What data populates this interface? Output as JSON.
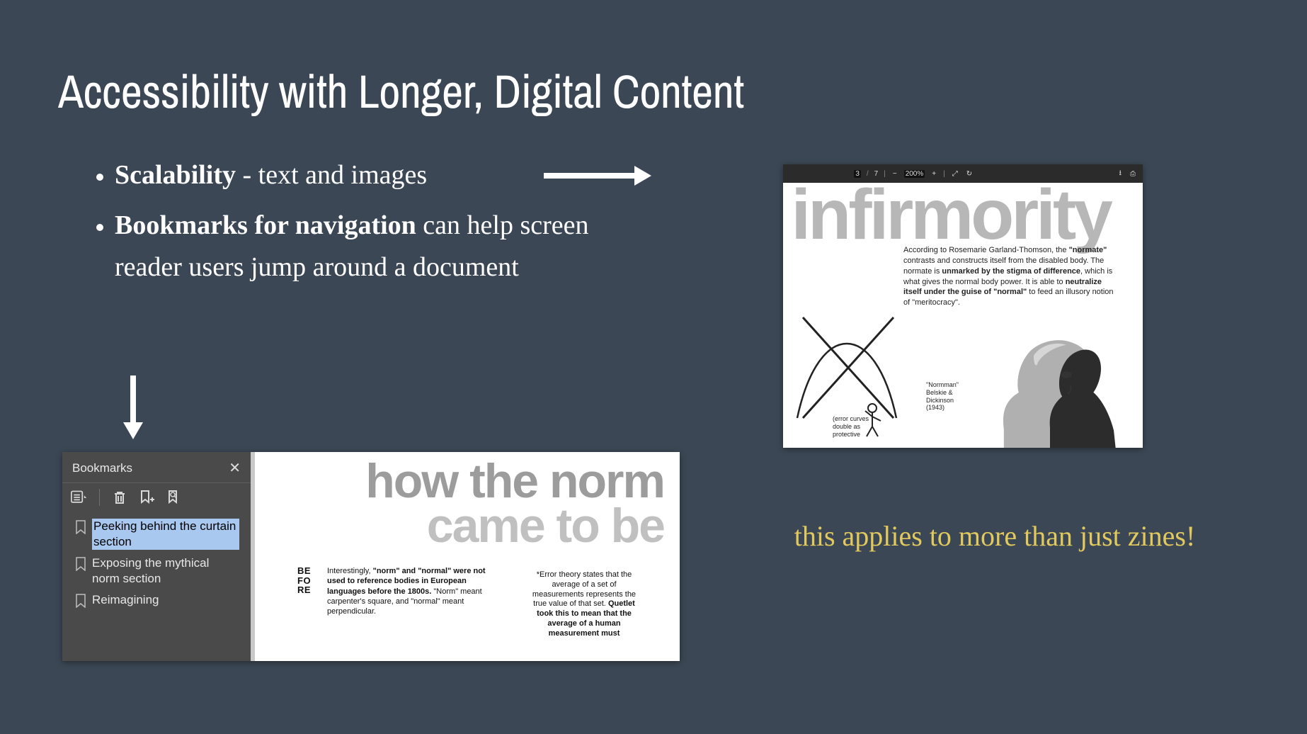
{
  "title": "Accessibility with Longer, Digital Content",
  "bullets": [
    {
      "lead": "Scalability",
      "rest": " - text and images"
    },
    {
      "lead": "Bookmarks for navigation",
      "rest": " can help screen reader users jump around a document"
    }
  ],
  "caption": "this applies to more than just zines!",
  "pdf": {
    "toolbar": {
      "page_cur": "3",
      "page_sep": "/",
      "page_total": "7",
      "zoom_minus": "−",
      "zoom_val": "200%",
      "zoom_plus": "+",
      "fit_page": "⤢",
      "rotate": "↻",
      "download": "⭳",
      "print": "⎙"
    },
    "bigword": "e infirmority",
    "para_1": "According to Rosemarie Garland-Thomson, the ",
    "para_b1": "\"normate\"",
    "para_2": " contrasts and constructs itself from the disabled body. The normate is ",
    "para_b2": "unmarked by the stigma of difference",
    "para_3": ", which is what gives the normal body power. It is able to ",
    "para_b3": "neutralize itself under the guise of \"normal\"",
    "para_4": " to feed an illusory notion of \"meritocracy\".",
    "sculpt_l1": "\"Normman\"",
    "sculpt_l2": "Belskie &",
    "sculpt_l3": "Dickinson",
    "sculpt_l4": "(1943)",
    "errnote_l1": "(error curves",
    "errnote_l2": "double as",
    "errnote_l3": "protective"
  },
  "bm": {
    "panel_title": "Bookmarks",
    "close": "✕",
    "items": [
      {
        "label": "Peeking behind the curtain section",
        "selected": true
      },
      {
        "label": "Exposing the mythical norm section",
        "selected": false
      },
      {
        "label": "Reimagining",
        "selected": false
      }
    ]
  },
  "doc": {
    "title_l1": "how the norm",
    "title_l2": "came to be",
    "side_1": "BE",
    "side_2": "FO",
    "side_3": "RE",
    "col_a_1": "Interestingly, ",
    "col_a_b": "\"norm\" and \"normal\" were not used to reference bodies in European languages before the 1800s.",
    "col_a_2": " \"Norm\" meant carpenter's square, and \"normal\" meant perpendicular.",
    "col_b_1": "*Error theory states that the average of a set of measurements represents the true value of that set. ",
    "col_b_b": "Quetlet took this to mean that the average of a human measurement must"
  }
}
